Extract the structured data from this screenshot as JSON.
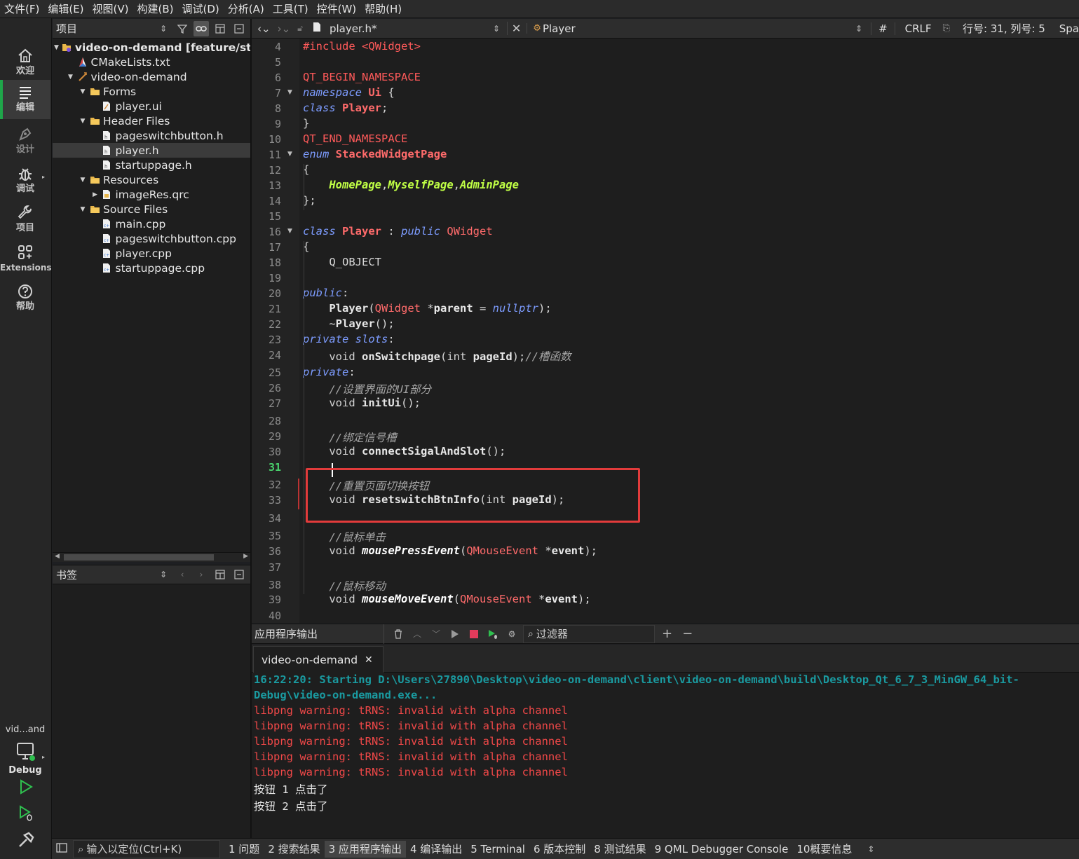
{
  "menu": [
    "文件(F)",
    "编辑(E)",
    "视图(V)",
    "构建(B)",
    "调试(D)",
    "分析(A)",
    "工具(T)",
    "控件(W)",
    "帮助(H)"
  ],
  "modes": [
    {
      "label": "欢迎",
      "icon": "home-icon"
    },
    {
      "label": "编辑",
      "icon": "edit-icon"
    },
    {
      "label": "设计",
      "icon": "design-icon"
    },
    {
      "label": "调试",
      "icon": "debug-icon"
    },
    {
      "label": "项目",
      "icon": "project-icon"
    },
    {
      "label": "Extensions",
      "icon": "extensions-icon"
    },
    {
      "label": "帮助",
      "icon": "help-icon"
    }
  ],
  "kit": {
    "project": "vid...and",
    "build": "Debug"
  },
  "project_pane": {
    "title": "项目",
    "tree": [
      {
        "label": "video-on-demand [feature/start",
        "depth": 0,
        "expanded": true,
        "icon": "project-root-icon"
      },
      {
        "label": "CMakeLists.txt",
        "depth": 1,
        "icon": "cmake-file-icon"
      },
      {
        "label": "video-on-demand",
        "depth": 1,
        "expanded": true,
        "icon": "target-icon"
      },
      {
        "label": "Forms",
        "depth": 2,
        "expanded": true,
        "icon": "folder-icon"
      },
      {
        "label": "player.ui",
        "depth": 3,
        "icon": "ui-file-icon"
      },
      {
        "label": "Header Files",
        "depth": 2,
        "expanded": true,
        "icon": "folder-icon"
      },
      {
        "label": "pageswitchbutton.h",
        "depth": 3,
        "icon": "header-file-icon"
      },
      {
        "label": "player.h",
        "depth": 3,
        "icon": "header-file-icon"
      },
      {
        "label": "startuppage.h",
        "depth": 3,
        "icon": "header-file-icon"
      },
      {
        "label": "Resources",
        "depth": 2,
        "expanded": true,
        "icon": "folder-icon"
      },
      {
        "label": "imageRes.qrc",
        "depth": 3,
        "expanded": false,
        "icon": "qrc-file-icon"
      },
      {
        "label": "Source Files",
        "depth": 2,
        "expanded": true,
        "icon": "folder-icon"
      },
      {
        "label": "main.cpp",
        "depth": 3,
        "icon": "cpp-file-icon"
      },
      {
        "label": "pageswitchbutton.cpp",
        "depth": 3,
        "icon": "cpp-file-icon"
      },
      {
        "label": "player.cpp",
        "depth": 3,
        "icon": "cpp-file-icon"
      },
      {
        "label": "startuppage.cpp",
        "depth": 3,
        "icon": "cpp-file-icon"
      }
    ],
    "selected_index": 7
  },
  "bookmarks_pane": {
    "title": "书签"
  },
  "editor_toolbar": {
    "file": "player.h*",
    "symbol": "Player",
    "hash": "#",
    "line_ending": "CRLF",
    "position": "行号: 31, 列号: 5",
    "indent": "Spa"
  },
  "editor": {
    "first_line": 4,
    "current_line": 31,
    "lines": [
      {
        "n": 4,
        "tokens": [
          [
            "pp",
            "#include <QWidget>"
          ]
        ]
      },
      {
        "n": 5,
        "tokens": []
      },
      {
        "n": 6,
        "tokens": [
          [
            "pp",
            "QT_BEGIN_NAMESPACE"
          ]
        ]
      },
      {
        "n": 7,
        "fold": true,
        "tokens": [
          [
            "kw",
            "namespace"
          ],
          [
            "q",
            " "
          ],
          [
            "tb",
            "Ui"
          ],
          [
            "q",
            " {"
          ]
        ]
      },
      {
        "n": 8,
        "tokens": [
          [
            "kw",
            "class"
          ],
          [
            "q",
            " "
          ],
          [
            "tb",
            "Player"
          ],
          [
            "q",
            ";"
          ]
        ]
      },
      {
        "n": 9,
        "tokens": [
          [
            "q",
            "}"
          ]
        ]
      },
      {
        "n": 10,
        "tokens": [
          [
            "pp",
            "QT_END_NAMESPACE"
          ]
        ]
      },
      {
        "n": 11,
        "fold": true,
        "tokens": [
          [
            "kw",
            "enum"
          ],
          [
            "q",
            " "
          ],
          [
            "tb",
            "StackedWidgetPage"
          ]
        ]
      },
      {
        "n": 12,
        "tokens": [
          [
            "q",
            "{"
          ]
        ]
      },
      {
        "n": 13,
        "tokens": [
          [
            "q",
            "    "
          ],
          [
            "en",
            "HomePage"
          ],
          [
            "q",
            ","
          ],
          [
            "en",
            "MyselfPage"
          ],
          [
            "q",
            ","
          ],
          [
            "en",
            "AdminPage"
          ]
        ]
      },
      {
        "n": 14,
        "tokens": [
          [
            "q",
            "};"
          ]
        ]
      },
      {
        "n": 15,
        "tokens": []
      },
      {
        "n": 16,
        "fold": true,
        "tokens": [
          [
            "kw",
            "class"
          ],
          [
            "q",
            " "
          ],
          [
            "tb",
            "Player"
          ],
          [
            "q",
            " : "
          ],
          [
            "kw",
            "public"
          ],
          [
            "q",
            " "
          ],
          [
            "ty",
            "QWidget"
          ]
        ]
      },
      {
        "n": 17,
        "tokens": [
          [
            "q",
            "{"
          ]
        ]
      },
      {
        "n": 18,
        "tokens": [
          [
            "q",
            "    Q_OBJECT"
          ]
        ]
      },
      {
        "n": 19,
        "tokens": []
      },
      {
        "n": 20,
        "tokens": [
          [
            "kw",
            "public"
          ],
          [
            "q",
            ":"
          ]
        ]
      },
      {
        "n": 21,
        "tokens": [
          [
            "q",
            "    "
          ],
          [
            "fn",
            "Player"
          ],
          [
            "q",
            "("
          ],
          [
            "ty",
            "QWidget"
          ],
          [
            "q",
            " *"
          ],
          [
            "vr",
            "parent"
          ],
          [
            "q",
            " = "
          ],
          [
            "nl",
            "nullptr"
          ],
          [
            "q",
            ");"
          ]
        ]
      },
      {
        "n": 22,
        "tokens": [
          [
            "q",
            "    ~"
          ],
          [
            "fn",
            "Player"
          ],
          [
            "q",
            "();"
          ]
        ]
      },
      {
        "n": 23,
        "tokens": [
          [
            "kw",
            "private"
          ],
          [
            "q",
            " "
          ],
          [
            "kw",
            "slots"
          ],
          [
            "q",
            ":"
          ]
        ]
      },
      {
        "n": 24,
        "tokens": [
          [
            "q",
            "    "
          ],
          [
            "pl",
            "void"
          ],
          [
            "q",
            " "
          ],
          [
            "fn",
            "onSwitchpage"
          ],
          [
            "q",
            "("
          ],
          [
            "pl",
            "int"
          ],
          [
            "q",
            " "
          ],
          [
            "vr",
            "pageId"
          ],
          [
            "q",
            ");"
          ],
          [
            "cm",
            "//槽函数"
          ]
        ]
      },
      {
        "n": 25,
        "tokens": [
          [
            "kw",
            "private"
          ],
          [
            "q",
            ":"
          ]
        ]
      },
      {
        "n": 26,
        "tokens": [
          [
            "q",
            "    "
          ],
          [
            "cm",
            "//设置界面的UI部分"
          ]
        ]
      },
      {
        "n": 27,
        "tokens": [
          [
            "q",
            "    "
          ],
          [
            "pl",
            "void"
          ],
          [
            "q",
            " "
          ],
          [
            "fn",
            "initUi"
          ],
          [
            "q",
            "();"
          ]
        ]
      },
      {
        "n": 28,
        "tokens": []
      },
      {
        "n": 29,
        "tokens": [
          [
            "q",
            "    "
          ],
          [
            "cm",
            "//绑定信号槽"
          ]
        ]
      },
      {
        "n": 30,
        "tokens": [
          [
            "q",
            "    "
          ],
          [
            "pl",
            "void"
          ],
          [
            "q",
            " "
          ],
          [
            "fn",
            "connectSigalAndSlot"
          ],
          [
            "q",
            "();"
          ]
        ]
      },
      {
        "n": 31,
        "tokens": []
      },
      {
        "n": 32,
        "changed": true,
        "tokens": [
          [
            "q",
            "    "
          ],
          [
            "cm",
            "//重置页面切换按钮"
          ]
        ]
      },
      {
        "n": 33,
        "changed": true,
        "tokens": [
          [
            "q",
            "    "
          ],
          [
            "pl",
            "void"
          ],
          [
            "q",
            " "
          ],
          [
            "fn",
            "resetswitchBtnInfo"
          ],
          [
            "q",
            "("
          ],
          [
            "pl",
            "int"
          ],
          [
            "q",
            " "
          ],
          [
            "vr",
            "pageId"
          ],
          [
            "q",
            ");"
          ]
        ]
      },
      {
        "n": 34,
        "tokens": []
      },
      {
        "n": 35,
        "tokens": [
          [
            "q",
            "    "
          ],
          [
            "cm",
            "//鼠标单击"
          ]
        ]
      },
      {
        "n": 36,
        "tokens": [
          [
            "q",
            "    "
          ],
          [
            "pl",
            "void"
          ],
          [
            "q",
            " "
          ],
          [
            "fi",
            "mousePressEvent"
          ],
          [
            "q",
            "("
          ],
          [
            "ty",
            "QMouseEvent"
          ],
          [
            "q",
            " *"
          ],
          [
            "vr",
            "event"
          ],
          [
            "q",
            ");"
          ]
        ]
      },
      {
        "n": 37,
        "tokens": []
      },
      {
        "n": 38,
        "tokens": [
          [
            "q",
            "    "
          ],
          [
            "cm",
            "//鼠标移动"
          ]
        ]
      },
      {
        "n": 39,
        "tokens": [
          [
            "q",
            "    "
          ],
          [
            "pl",
            "void"
          ],
          [
            "q",
            " "
          ],
          [
            "fi",
            "mouseMoveEvent"
          ],
          [
            "q",
            "("
          ],
          [
            "ty",
            "QMouseEvent"
          ],
          [
            "q",
            " *"
          ],
          [
            "vr",
            "event"
          ],
          [
            "q",
            ");"
          ]
        ]
      },
      {
        "n": 40,
        "tokens": []
      }
    ]
  },
  "output_pane": {
    "title": "应用程序输出",
    "filter_placeholder": "过滤器",
    "tab": "video-on-demand",
    "lines": [
      {
        "kind": "start",
        "text": "16:22:20: Starting D:\\Users\\27890\\Desktop\\video-on-demand\\client\\video-on-demand\\build\\Desktop_Qt_6_7_3_MinGW_64_bit-"
      },
      {
        "kind": "start",
        "text": "Debug\\video-on-demand.exe..."
      },
      {
        "kind": "warn",
        "text": "libpng warning: tRNS: invalid with alpha channel"
      },
      {
        "kind": "warn",
        "text": "libpng warning: tRNS: invalid with alpha channel"
      },
      {
        "kind": "warn",
        "text": "libpng warning: tRNS: invalid with alpha channel"
      },
      {
        "kind": "warn",
        "text": "libpng warning: tRNS: invalid with alpha channel"
      },
      {
        "kind": "warn",
        "text": "libpng warning: tRNS: invalid with alpha channel"
      },
      {
        "kind": "plain",
        "text": "按钮 1 点击了"
      },
      {
        "kind": "plain",
        "text": "按钮 2 点击了"
      }
    ]
  },
  "statusbar": {
    "locator_placeholder": "输入以定位(Ctrl+K)",
    "tabs": [
      "1 问题",
      "2 搜索结果",
      "3 应用程序输出",
      "4 编译输出",
      "5 Terminal",
      "6 版本控制",
      "8 测试结果",
      "9 QML Debugger Console",
      "10概要信息"
    ],
    "active_tab": 2
  },
  "colors": {
    "accent": "#1fa64a",
    "highlight_box": "#e23b3b",
    "warning": "#f04848",
    "start": "#1a9aa0"
  }
}
